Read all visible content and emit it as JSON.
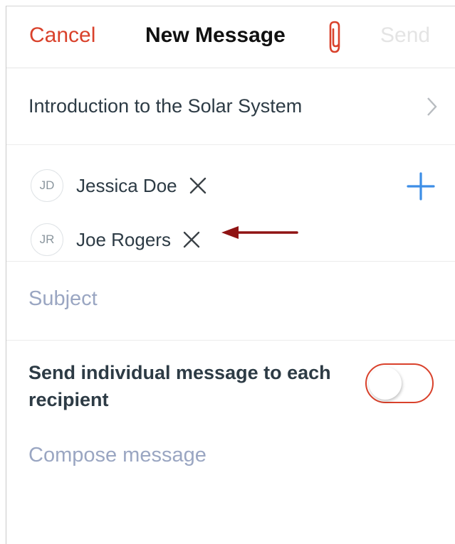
{
  "header": {
    "cancel_label": "Cancel",
    "title": "New Message",
    "attach_icon": "paperclip-icon",
    "send_label": "Send"
  },
  "course": {
    "label": "Introduction to the Solar System",
    "chevron_icon": "chevron-right-icon"
  },
  "recipients": [
    {
      "initials": "JD",
      "name": "Jessica Doe"
    },
    {
      "initials": "JR",
      "name": "Joe Rogers"
    }
  ],
  "add_recipient_icon": "plus-icon",
  "subject": {
    "placeholder": "Subject",
    "value": ""
  },
  "individual_toggle": {
    "label": "Send individual message to each recipient",
    "checked": false
  },
  "compose": {
    "placeholder": "Compose message",
    "value": ""
  },
  "colors": {
    "accent": "#d9412b",
    "add_button": "#3d8ee6",
    "annotation_arrow": "#8f1313",
    "placeholder": "#9aa6c2",
    "send_disabled": "#e4e4e4"
  }
}
